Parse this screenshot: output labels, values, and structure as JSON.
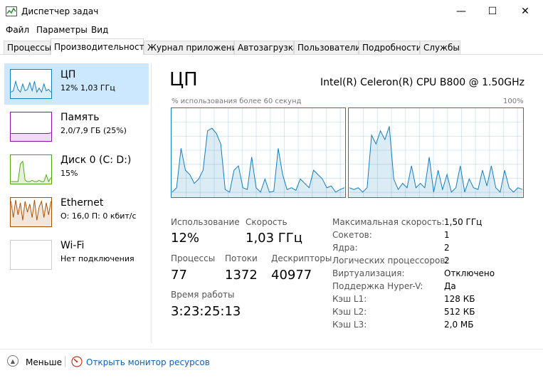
{
  "window": {
    "title": "Диспетчер задач",
    "minimize_glyph": "—",
    "maximize_glyph": "☐",
    "close_glyph": "✕"
  },
  "menu": [
    "Файл",
    "Параметры",
    "Вид"
  ],
  "tabs": [
    {
      "label": "Процессы",
      "active": false
    },
    {
      "label": "Производительность",
      "active": true
    },
    {
      "label": "Журнал приложений",
      "active": false
    },
    {
      "label": "Автозагрузка",
      "active": false
    },
    {
      "label": "Пользователи",
      "active": false
    },
    {
      "label": "Подробности",
      "active": false
    },
    {
      "label": "Службы",
      "active": false
    }
  ],
  "sidebar": [
    {
      "name": "ЦП",
      "sub": "12% 1,03 ГГц",
      "color": "#117dbb",
      "icon": "cpu-graph-icon",
      "graph": [
        0.2,
        0.25,
        0.6,
        0.3,
        0.2,
        0.5,
        0.25,
        0.3,
        0.55,
        0.25,
        0.6,
        0.2,
        0.35,
        0.2,
        0.5,
        0.25,
        0.3,
        0.2
      ]
    },
    {
      "name": "Память",
      "sub": "2,0/7,9 ГБ (25%)",
      "color": "#8b12ae",
      "icon": "memory-graph-icon",
      "graph": [
        0.25,
        0.25,
        0.25,
        0.25,
        0.25,
        0.25,
        0.25,
        0.25,
        0.25,
        0.25,
        0.25,
        0.25,
        0.25,
        0.25,
        0.25,
        0.25,
        0.25,
        0.28
      ]
    },
    {
      "name": "Диск 0 (C: D:)",
      "sub": "15%",
      "color": "#4da60c",
      "icon": "disk-graph-icon",
      "graph": [
        0.05,
        0.05,
        0.05,
        0.05,
        0.7,
        0.8,
        0.1,
        0.05,
        0.05,
        0.1,
        0.05,
        0.05,
        0.1,
        0.05,
        0.05,
        0.3,
        0.05,
        0.2
      ]
    },
    {
      "name": "Ethernet",
      "sub": "О: 16,0 П: 0 кбит/с",
      "color": "#a74f01",
      "icon": "ethernet-graph-icon",
      "graph": [
        0.9,
        0.3,
        0.95,
        0.4,
        0.85,
        0.2,
        0.9,
        0.5,
        0.8,
        0.3,
        0.95,
        0.2,
        0.7,
        0.9,
        0.3,
        0.85,
        0.4,
        0.9
      ]
    },
    {
      "name": "Wi-Fi",
      "sub": "Нет подключения",
      "color": "#cccccc",
      "icon": "wifi-graph-icon",
      "graph": []
    }
  ],
  "main": {
    "title": "ЦП",
    "cpu_name": "Intel(R) Celeron(R) CPU B800 @ 1.50GHz",
    "graph_label": "% использования более 60 секунд",
    "graph_max": "100%",
    "core0": [
      0.05,
      0.1,
      0.55,
      0.3,
      0.25,
      0.15,
      0.2,
      0.3,
      0.75,
      0.78,
      0.72,
      0.6,
      0.08,
      0.05,
      0.3,
      0.35,
      0.1,
      0.08,
      0.45,
      0.1,
      0.05,
      0.2,
      0.05,
      0.06,
      0.55,
      0.25,
      0.08,
      0.1,
      0.07,
      0.2,
      0.15,
      0.1,
      0.3,
      0.25,
      0.2,
      0.1,
      0.12,
      0.05,
      0.08,
      0.1
    ],
    "core1": [
      0.1,
      0.08,
      0.1,
      0.05,
      0.1,
      0.7,
      0.6,
      0.75,
      0.65,
      0.8,
      0.2,
      0.08,
      0.15,
      0.1,
      0.35,
      0.1,
      0.15,
      0.1,
      0.45,
      0.05,
      0.3,
      0.08,
      0.25,
      0.05,
      0.1,
      0.35,
      0.05,
      0.2,
      0.1,
      0.08,
      0.3,
      0.12,
      0.35,
      0.1,
      0.05,
      0.3,
      0.1,
      0.05,
      0.1,
      0.08
    ],
    "stats": {
      "usage_label": "Использование",
      "usage_value": "12%",
      "speed_label": "Скорость",
      "speed_value": "1,03 ГГц",
      "processes_label": "Процессы",
      "processes_value": "77",
      "threads_label": "Потоки",
      "threads_value": "1372",
      "handles_label": "Дескрипторы",
      "handles_value": "40977",
      "uptime_label": "Время работы",
      "uptime_value": "3:23:25:13"
    },
    "details": [
      {
        "key": "Максимальная скорость:",
        "value": "1,50 ГГц"
      },
      {
        "key": "Сокетов:",
        "value": "1"
      },
      {
        "key": "Ядра:",
        "value": "2"
      },
      {
        "key": "Логических процессоров:",
        "value": "2"
      },
      {
        "key": "Виртуализация:",
        "value": "Отключено"
      },
      {
        "key": "Поддержка Hyper-V:",
        "value": "Да"
      },
      {
        "key": "Кэш L1:",
        "value": "128 КБ"
      },
      {
        "key": "Кэш L2:",
        "value": "512 КБ"
      },
      {
        "key": "Кэш L3:",
        "value": "2,0 МБ"
      }
    ]
  },
  "footer": {
    "less_label": "Меньше",
    "resmon_label": "Открыть монитор ресурсов"
  }
}
